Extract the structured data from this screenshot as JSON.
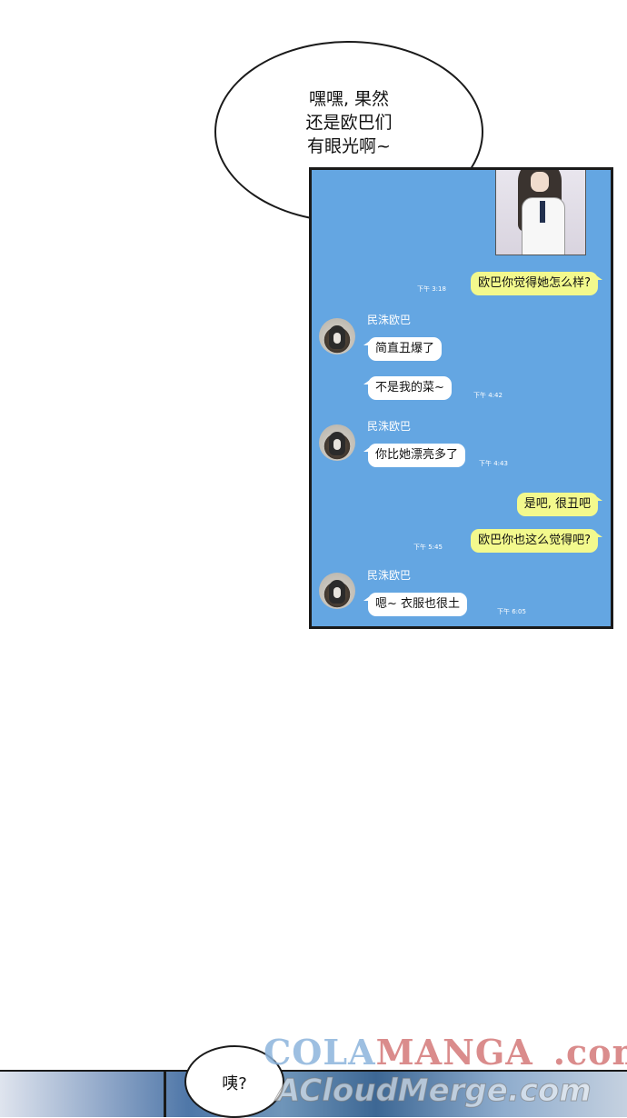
{
  "speech": {
    "text": "嘿嘿, 果然\n还是欧巴们\n有眼光啊~"
  },
  "chat": {
    "messages": [
      {
        "side": "me",
        "text": "欧巴你觉得她怎么样?",
        "time": "下午 3:18"
      },
      {
        "side": "them",
        "sender": "民洙欧巴",
        "text": "简直丑爆了",
        "time": ""
      },
      {
        "side": "them",
        "sender": "",
        "text": "不是我的菜~",
        "time": "下午 4:42"
      },
      {
        "side": "them",
        "sender": "民洙欧巴",
        "text": "你比她漂亮多了",
        "time": "下午 4:43"
      },
      {
        "side": "me",
        "text": "是吧, 很丑吧",
        "time": ""
      },
      {
        "side": "me",
        "text": "欧巴你也这么觉得吧?",
        "time": "下午 5:45"
      },
      {
        "side": "them",
        "sender": "民洙欧巴",
        "text": "嗯~ 衣服也很土",
        "time": "下午 6:05"
      }
    ],
    "colors": {
      "background": "#64a6e2",
      "my_bubble": "#f3f98d",
      "their_bubble": "#ffffff"
    }
  },
  "bottom": {
    "bubble_text": "咦?"
  },
  "watermark": {
    "line1_part1": "COLA",
    "line1_part2": "MANGA",
    "line1_part3": ".com",
    "line2": "ACloudMerge.com"
  }
}
